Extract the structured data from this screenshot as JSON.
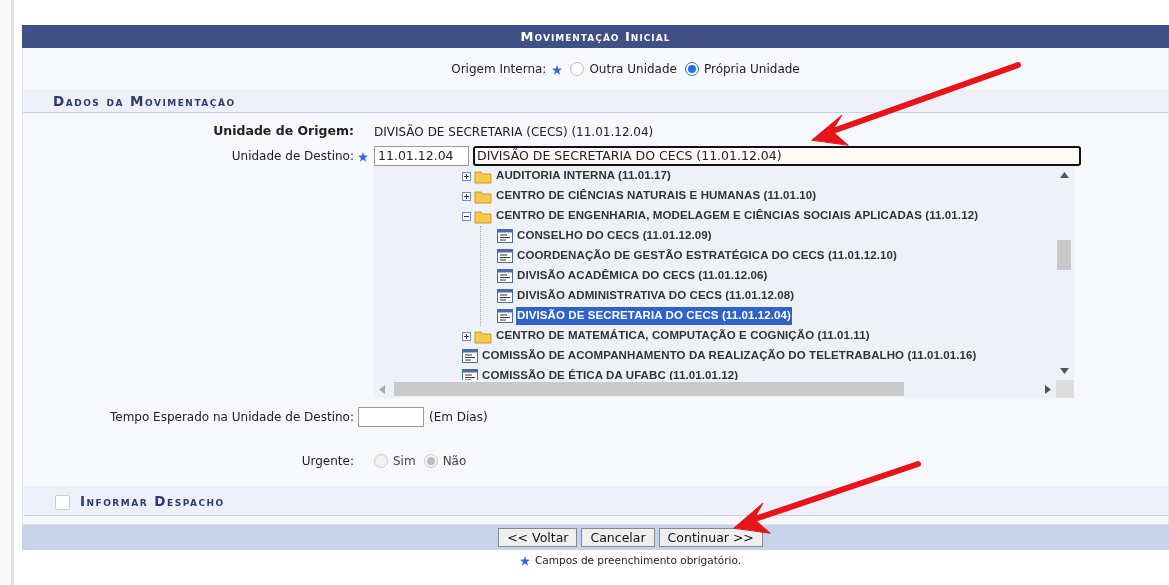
{
  "header": {
    "title": "Movimentação Inicial"
  },
  "origem_interna": {
    "label": "Origem Interna:",
    "required": true,
    "options": [
      {
        "label": "Outra Unidade",
        "selected": false
      },
      {
        "label": "Própria Unidade",
        "selected": true
      }
    ]
  },
  "section_dados": {
    "title": "Dados da Movimentação"
  },
  "unidade_origem": {
    "label": "Unidade de Origem:",
    "value": "DIVISÃO DE SECRETARIA (CECS) (11.01.12.04)"
  },
  "unidade_destino": {
    "label": "Unidade de Destino:",
    "required": true,
    "code": "11.01.12.04",
    "name": "DIVISÃO DE SECRETARIA DO CECS (11.01.12.04)"
  },
  "tree": [
    {
      "label": "AUDITORIA INTERNA (11.01.17)",
      "kind": "folder",
      "expanded": false,
      "selected": false
    },
    {
      "label": "CENTRO DE CIÊNCIAS NATURAIS E HUMANAS (11.01.10)",
      "kind": "folder",
      "expanded": false,
      "selected": false
    },
    {
      "label": "CENTRO DE ENGENHARIA, MODELAGEM E CIÊNCIAS SOCIAIS APLICADAS (11.01.12)",
      "kind": "folder",
      "expanded": true,
      "selected": false,
      "children": [
        {
          "label": "CONSELHO DO CECS (11.01.12.09)",
          "kind": "unit",
          "selected": false
        },
        {
          "label": "COORDENAÇÃO DE GESTÃO ESTRATÉGICA DO CECS (11.01.12.10)",
          "kind": "unit",
          "selected": false
        },
        {
          "label": "DIVISÃO ACADÊMICA DO CECS (11.01.12.06)",
          "kind": "unit",
          "selected": false
        },
        {
          "label": "DIVISÃO ADMINISTRATIVA DO CECS (11.01.12.08)",
          "kind": "unit",
          "selected": false
        },
        {
          "label": "DIVISÃO DE SECRETARIA DO CECS (11.01.12.04)",
          "kind": "unit",
          "selected": true
        }
      ]
    },
    {
      "label": "CENTRO DE MATEMÁTICA, COMPUTAÇÃO E COGNIÇÃO (11.01.11)",
      "kind": "folder",
      "expanded": false,
      "selected": false
    },
    {
      "label": "COMISSÃO DE ACOMPANHAMENTO DA REALIZAÇÃO DO TELETRABALHO (11.01.01.16)",
      "kind": "unit",
      "selected": false
    },
    {
      "label": "COMISSÃO DE ÉTICA DA UFABC (11.01.01.12)",
      "kind": "unit",
      "selected": false
    }
  ],
  "tempo": {
    "label": "Tempo Esperado na Unidade de Destino:",
    "suffix": "(Em Dias)"
  },
  "urgente": {
    "label": "Urgente:",
    "disabled": true,
    "options": [
      {
        "label": "Sim",
        "selected": false
      },
      {
        "label": "Não",
        "selected": true
      }
    ]
  },
  "section_despacho": {
    "title": "Informar Despacho",
    "checked": false
  },
  "buttons": [
    "<< Voltar",
    "Cancelar",
    "Continuar >>"
  ],
  "footnote": "Campos de preenchimento obrigatório."
}
